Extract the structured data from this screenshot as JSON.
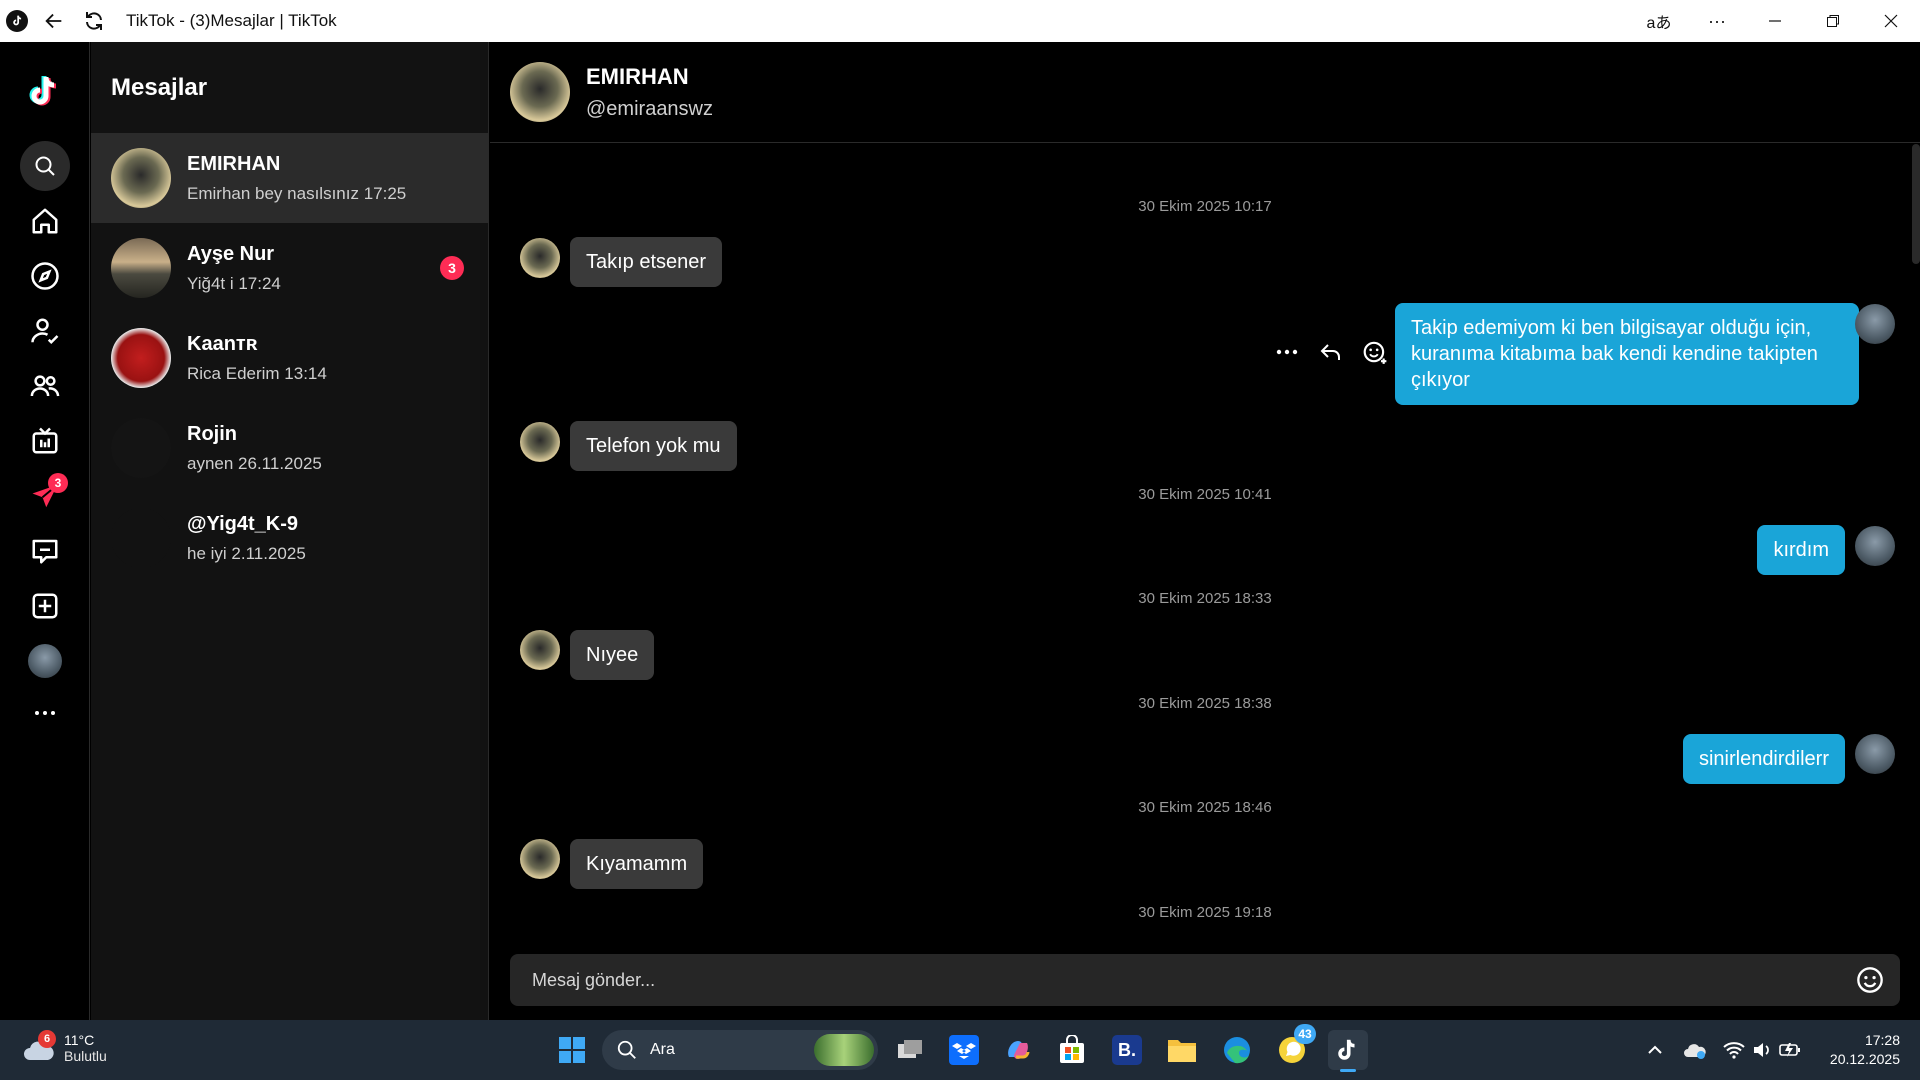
{
  "window": {
    "title": "TikTok - (3)Mesajlar | TikTok"
  },
  "rail": {
    "items": [
      {
        "icon": "tiktok-logo"
      },
      {
        "icon": "search-icon"
      },
      {
        "icon": "home-icon"
      },
      {
        "icon": "explore-icon"
      },
      {
        "icon": "following-icon"
      },
      {
        "icon": "friends-icon"
      },
      {
        "icon": "live-icon"
      },
      {
        "icon": "messages-icon",
        "badge": "3"
      },
      {
        "icon": "activity-icon"
      },
      {
        "icon": "upload-icon"
      },
      {
        "icon": "profile-avatar"
      },
      {
        "icon": "more-icon"
      }
    ],
    "accent": "#fe2c55"
  },
  "conversations": {
    "heading": "Mesajlar",
    "items": [
      {
        "name": "EMIRHAN",
        "preview": "Emirhan bey nasılsınız 17:25",
        "active": true
      },
      {
        "name": "Ayşe Nur",
        "preview": "Yiğ4t i 17:24",
        "unread": "3"
      },
      {
        "name": "Kaanᴛʀ",
        "preview": "Rica Ederim 13:14"
      },
      {
        "name": "Rojin",
        "preview": "aynen 26.11.2025"
      },
      {
        "name": "@Yig4t_K-9",
        "preview": "he iyi 2.11.2025"
      }
    ]
  },
  "chat": {
    "name": "EMIRHAN",
    "handle": "@emiraanswz",
    "messages": [
      {
        "type": "timestamp",
        "text": "30 Ekim 2025 10:17"
      },
      {
        "type": "in",
        "text": "Takıp etsener"
      },
      {
        "type": "out",
        "text": "Takip edemiyom ki ben bilgisayar olduğu için, kuranıma kitabıma bak kendi kendine takipten çıkıyor"
      },
      {
        "type": "in",
        "text": "Telefon yok mu"
      },
      {
        "type": "timestamp",
        "text": "30 Ekim 2025 10:41"
      },
      {
        "type": "out",
        "text": "kırdım"
      },
      {
        "type": "timestamp",
        "text": "30 Ekim 2025 18:33"
      },
      {
        "type": "in",
        "text": "Nıyee"
      },
      {
        "type": "timestamp",
        "text": "30 Ekim 2025 18:38"
      },
      {
        "type": "out",
        "text": "sinirlendirdilerr"
      },
      {
        "type": "timestamp",
        "text": "30 Ekim 2025 18:46"
      },
      {
        "type": "in",
        "text": "Kıyamamm"
      },
      {
        "type": "timestamp",
        "text": "30 Ekim 2025 19:18"
      }
    ],
    "composer_placeholder": "Mesaj gönder...",
    "incoming_color": "#3a3a3a",
    "outgoing_color": "#1aa5d8"
  },
  "taskbar": {
    "weather_badge": "6",
    "temperature": "11°C",
    "condition": "Bulutlu",
    "search_label": "Ara",
    "whatsapp_badge": "43",
    "time": "17:28",
    "date": "20.12.2025"
  }
}
